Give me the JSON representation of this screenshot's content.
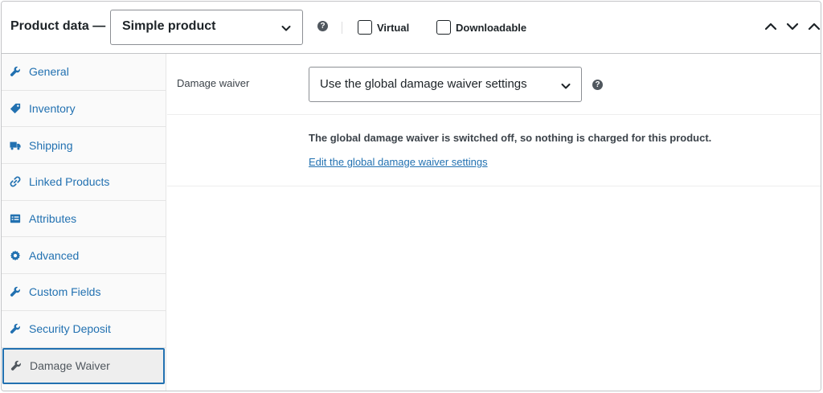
{
  "header": {
    "title": "Product data —",
    "product_type": "Simple product",
    "virtual_label": "Virtual",
    "downloadable_label": "Downloadable"
  },
  "tabs": [
    {
      "label": "General",
      "icon": "wrench-icon"
    },
    {
      "label": "Inventory",
      "icon": "tag-icon"
    },
    {
      "label": "Shipping",
      "icon": "truck-icon"
    },
    {
      "label": "Linked Products",
      "icon": "link-icon"
    },
    {
      "label": "Attributes",
      "icon": "list-icon"
    },
    {
      "label": "Advanced",
      "icon": "gear-icon"
    },
    {
      "label": "Custom Fields",
      "icon": "wrench-icon"
    },
    {
      "label": "Security Deposit",
      "icon": "wrench-icon"
    },
    {
      "label": "Damage Waiver",
      "icon": "wrench-icon"
    }
  ],
  "active_tab": "Damage Waiver",
  "main": {
    "field_label": "Damage waiver",
    "field_value": "Use the global damage waiver settings",
    "info_text": "The global damage waiver is switched off, so nothing is charged for this product.",
    "link_text": "Edit the global damage waiver settings"
  },
  "colors": {
    "link": "#2271b1",
    "border": "#c3c4c7",
    "text": "#1d2327",
    "help_icon": "#50575e"
  }
}
